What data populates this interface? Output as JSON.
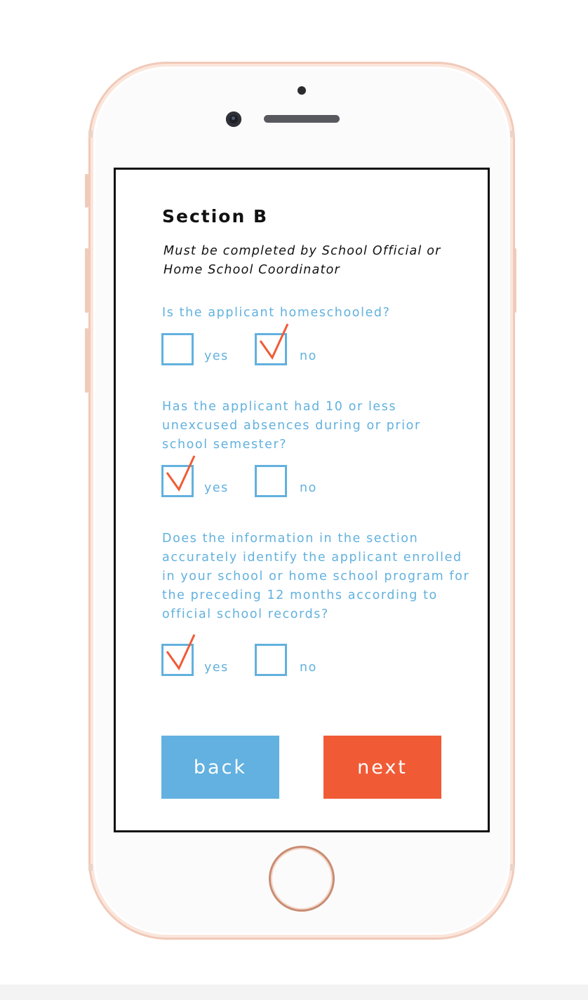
{
  "form": {
    "title": "Section B",
    "subtitle": "Must be completed by School Official or Home School Coordinator",
    "questions": [
      {
        "text": "Is the applicant homeschooled?",
        "options": [
          {
            "label": "yes",
            "checked": false
          },
          {
            "label": "no",
            "checked": true
          }
        ]
      },
      {
        "text": "Has the applicant had 10 or less unexcused absences during or prior school semester?",
        "options": [
          {
            "label": "yes",
            "checked": true
          },
          {
            "label": "no",
            "checked": false
          }
        ]
      },
      {
        "text": "Does the information in the section accurately identify the applicant enrolled in your school or home school program for the preceding 12 months according to official school records?",
        "options": [
          {
            "label": "yes",
            "checked": true
          },
          {
            "label": "no",
            "checked": false
          }
        ]
      }
    ]
  },
  "buttons": {
    "back_label": "back",
    "next_label": "next"
  },
  "colors": {
    "accent_blue": "#62b1de",
    "accent_orange": "#f05b36",
    "check_mark": "#f05b36",
    "phone_frame": "#f1c9b8"
  },
  "icons": {
    "checkmark": "checkmark-icon",
    "home_button": "home-button-icon",
    "camera": "camera-icon"
  }
}
